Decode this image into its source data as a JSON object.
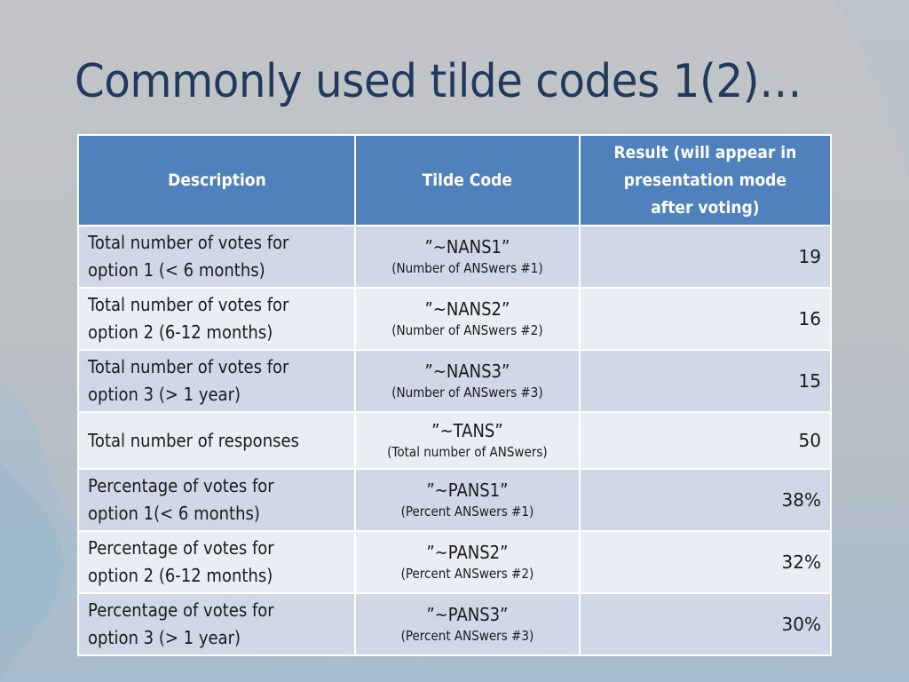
{
  "slide": {
    "title": "Commonly used tilde codes 1(2)…",
    "colors": {
      "title": "#1f3a5c",
      "header_bg": "#4f81bd",
      "row_odd_bg": "#d0d8e8",
      "row_even_bg": "#e9edf4"
    }
  },
  "table": {
    "headers": {
      "description": "Description",
      "tilde_code": "Tilde Code",
      "result": "Result (will appear in presentation mode after voting)"
    },
    "rows": [
      {
        "description": "Total number of votes for option 1 (< 6 months)",
        "code": "”~NANS1”",
        "code_note": "(Number of ANSwers #1)",
        "result": "19"
      },
      {
        "description": "Total number of votes for option 2 (6-12 months)",
        "code": "”~NANS2”",
        "code_note": "(Number of ANSwers #2)",
        "result": "16"
      },
      {
        "description": "Total number of votes for option 3 (> 1 year)",
        "code": "”~NANS3”",
        "code_note": "(Number of ANSwers #3)",
        "result": "15"
      },
      {
        "description": "Total number of responses",
        "code": "”~TANS”",
        "code_note": "(Total number of ANSwers)",
        "result": "50"
      },
      {
        "description": "Percentage of votes for option 1(< 6 months)",
        "code": "”~PANS1”",
        "code_note": "(Percent ANSwers #1)",
        "result": "38%"
      },
      {
        "description": "Percentage of votes for option 2 (6-12 months)",
        "code": "”~PANS2”",
        "code_note": "(Percent ANSwers #2)",
        "result": "32%"
      },
      {
        "description": "Percentage of votes for option 3 (> 1 year)",
        "code": "”~PANS3”",
        "code_note": "(Percent ANSwers #3)",
        "result": "30%"
      }
    ]
  }
}
